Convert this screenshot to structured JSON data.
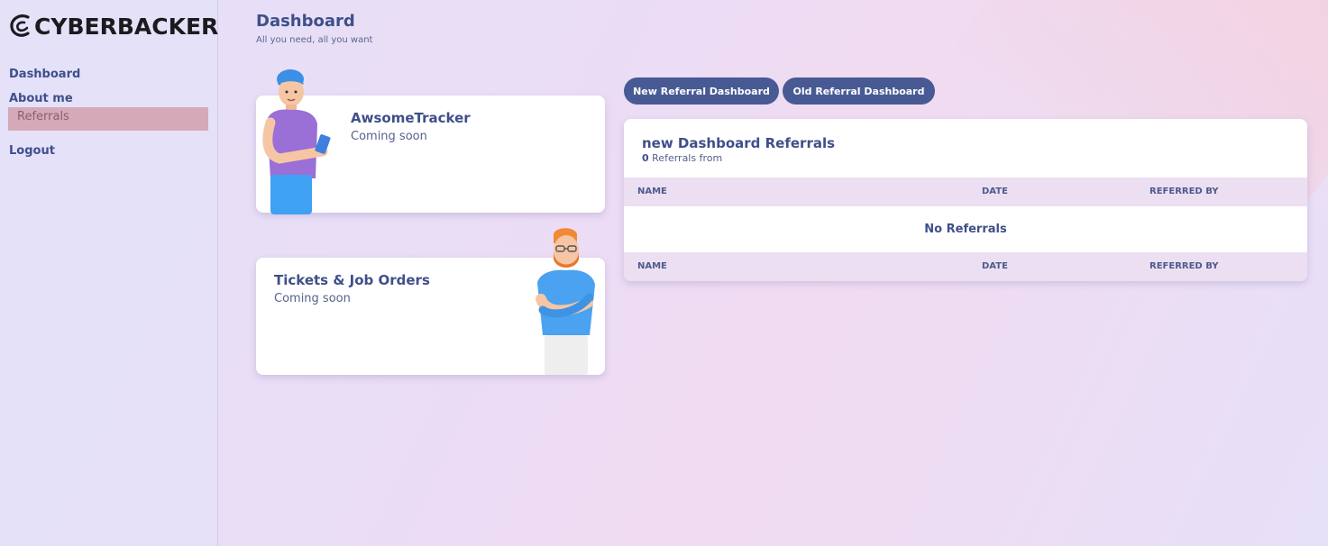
{
  "brand": {
    "name": "CYBERBACKER"
  },
  "sidebar": {
    "items": [
      {
        "label": "Dashboard"
      },
      {
        "label": "About me"
      },
      {
        "label": "Referrals",
        "active": true
      },
      {
        "label": "Logout"
      }
    ]
  },
  "header": {
    "title": "Dashboard",
    "subtitle": "All you need, all you want"
  },
  "cards": {
    "tracker": {
      "title": "AwsomeTracker",
      "subtitle": "Coming soon"
    },
    "tickets": {
      "title": "Tickets & Job Orders",
      "subtitle": "Coming soon"
    }
  },
  "buttons": {
    "new_dashboard": "New Referral Dashboard",
    "old_dashboard": "Old Referral Dashboard"
  },
  "referrals": {
    "title": "new Dashboard Referrals",
    "count": "0",
    "count_suffix": "Referrals from",
    "columns": [
      "NAME",
      "DATE",
      "REFERRED BY"
    ],
    "empty_message": "No Referrals"
  },
  "colors": {
    "accent": "#485a94",
    "text": "#3f4f8a",
    "active_nav_bg": "#d5a9b7",
    "table_header_bg": "#ecdff2"
  },
  "icons": [
    "cyberbacker-logo-icon",
    "avatar-illustration-tablet",
    "avatar-illustration-arms-crossed"
  ]
}
